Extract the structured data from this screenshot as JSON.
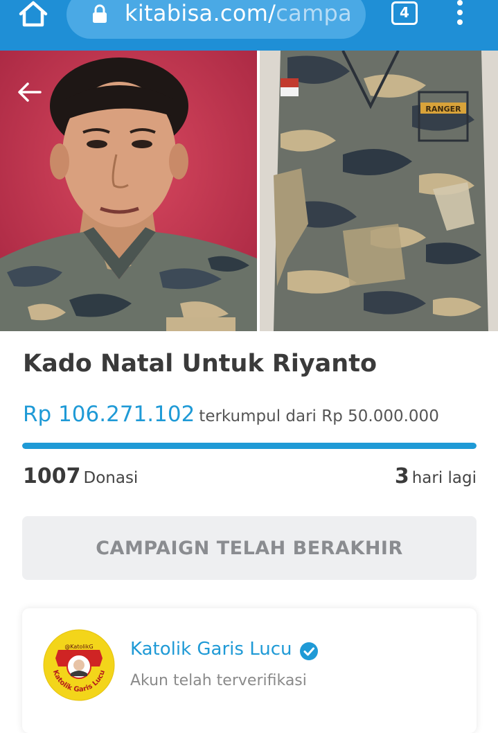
{
  "browser": {
    "url_main": "kitabisa.com/",
    "url_faded": "campa",
    "tab_count": "4",
    "home_icon": "home-icon",
    "lock_icon": "lock-icon",
    "menu_icon": "kebab-menu-icon",
    "accent": "#1f8fd6"
  },
  "hero": {
    "back_icon": "arrow-left-icon",
    "shirt_tag": "RANGER"
  },
  "campaign": {
    "title": "Kado Natal Untuk Riyanto",
    "raised": "Rp 106.271.102",
    "raised_suffix": "terkumpul dari Rp 50.000.000",
    "progress_fraction": 1.0,
    "donations_count": "1007",
    "donations_label": "Donasi",
    "days_count": "3",
    "days_label": "hari lagi",
    "ended_button": "CAMPAIGN TELAH BERAKHIR",
    "accent": "#1f9ad6"
  },
  "organizer": {
    "name": "Katolik Garis Lucu",
    "status": "Akun telah terverifikasi",
    "logo_top_text": "@KatolikG",
    "logo_ring_text": "Katolik Garis Lucu",
    "verified_icon": "verified-badge-icon"
  }
}
